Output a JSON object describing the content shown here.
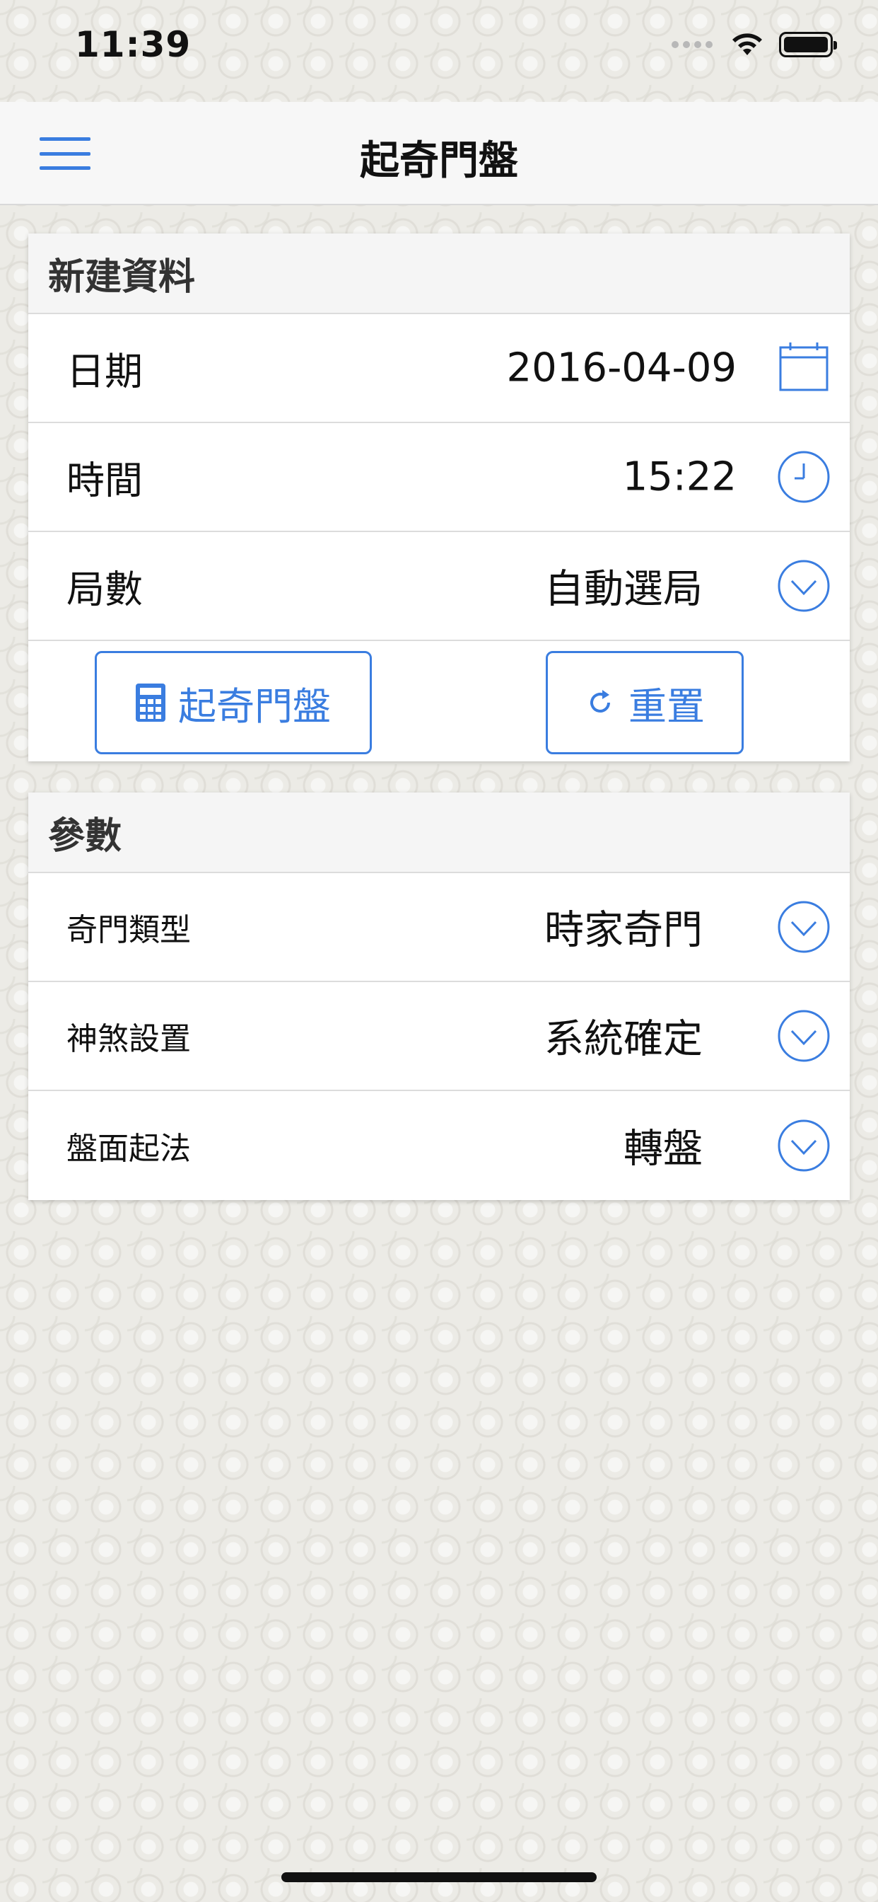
{
  "status_bar": {
    "time": "11:39",
    "icons": [
      "signal-dots-icon",
      "wifi-icon",
      "battery-icon"
    ]
  },
  "nav": {
    "title": "起奇門盤",
    "menu_icon": "hamburger-menu-icon"
  },
  "new_data": {
    "header": "新建資料",
    "rows": [
      {
        "label": "日期",
        "value": "2016-04-09",
        "icon": "calendar-icon"
      },
      {
        "label": "時間",
        "value": "15:22",
        "icon": "clock-icon"
      },
      {
        "label": "局數",
        "value": "自動選局",
        "icon": "chevron-down-circle-icon"
      }
    ],
    "buttons": {
      "calculate_label": "起奇門盤",
      "calculate_icon": "calculator-icon",
      "reset_label": "重置",
      "reset_icon": "refresh-icon"
    }
  },
  "params": {
    "header": "參數",
    "rows": [
      {
        "label": "奇門類型",
        "value": "時家奇門",
        "icon": "chevron-down-circle-icon"
      },
      {
        "label": "神煞設置",
        "value": "系統確定",
        "icon": "chevron-down-circle-icon"
      },
      {
        "label": "盤面起法",
        "value": "轉盤",
        "icon": "chevron-down-circle-icon"
      }
    ]
  },
  "colors": {
    "accent": "#3a7de0",
    "background": "#ecebe6",
    "card": "#ffffff",
    "header": "#f5f5f5"
  }
}
